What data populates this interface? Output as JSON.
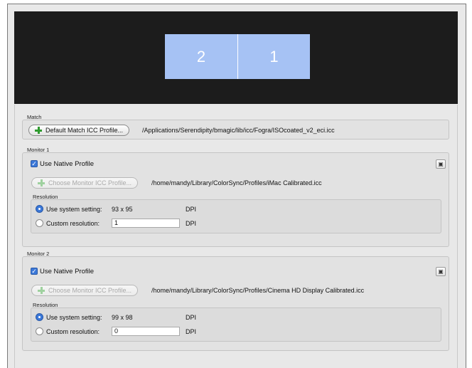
{
  "display": {
    "monitor_left": "2",
    "monitor_right": "1"
  },
  "match": {
    "section_label": "Match",
    "button_label": "Default Match ICC Profile...",
    "profile_path": "/Applications/Serendipity/bmagic/lib/icc/Fogra/ISOcoated_v2_eci.icc"
  },
  "monitor1": {
    "section_label": "Monitor 1",
    "use_native_label": "Use Native Profile",
    "use_native_checked": true,
    "choose_button_label": "Choose Monitor ICC Profile...",
    "profile_path": "/home/mandy/Library/ColorSync/Profiles/iMac Calibrated.icc",
    "resolution_label": "Resolution",
    "system_setting_label": "Use system setting:",
    "system_setting_value": "93 x 95",
    "system_unit": "DPI",
    "custom_label": "Custom resolution:",
    "custom_value": "1",
    "custom_unit": "DPI",
    "selected": "system"
  },
  "monitor2": {
    "section_label": "Monitor 2",
    "use_native_label": "Use Native Profile",
    "use_native_checked": true,
    "choose_button_label": "Choose Monitor ICC Profile...",
    "profile_path": "/home/mandy/Library/ColorSync/Profiles/Cinema HD Display Calibrated.icc",
    "resolution_label": "Resolution",
    "system_setting_label": "Use system setting:",
    "system_setting_value": "99 x 98",
    "system_unit": "DPI",
    "custom_label": "Custom resolution:",
    "custom_value": "0",
    "custom_unit": "DPI",
    "selected": "system"
  },
  "icons": {
    "add": "plus-icon",
    "identify": "display-identify-icon",
    "check": "checkmark-icon"
  },
  "colors": {
    "monitor_fill": "#a6c2f4",
    "display_bg": "#1c1c1c",
    "accent": "#3b78d8",
    "add_green": "#2f9a2f"
  }
}
